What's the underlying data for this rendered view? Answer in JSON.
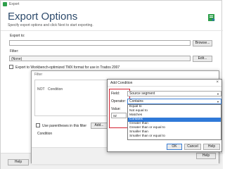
{
  "window": {
    "title": "Export"
  },
  "header": {
    "title": "Export Options",
    "subtitle": "Specify export options and click Next to start exporting."
  },
  "export_to": {
    "label": "Export to:",
    "value": "",
    "browse_label": "Browse..."
  },
  "filter": {
    "label": "Filter:",
    "value": "(None)",
    "edit_label": "Edit..."
  },
  "workbench": {
    "label": "Export to Workbench-optimized TMX format for use in Trados 2007",
    "checked": false
  },
  "footer": {
    "help_label": "Help"
  },
  "filter_dialog": {
    "title": "Filter",
    "tree": {
      "not_label": "NOT",
      "condition_label": "Condition"
    },
    "parentheses_label": "Use parentheses in this filter",
    "add_label": "Add...",
    "condition_label": "Condition",
    "help_label": "Help"
  },
  "add_condition": {
    "title": "Add Condition",
    "close_icon": "×",
    "field_label": "Field:",
    "field_value": "Source segment",
    "operator_label": "Operator:",
    "operator_value": "Contains",
    "value_label": "Value:",
    "value_value": "sz",
    "operator_options": [
      "Equal to",
      "Not equal to",
      "Matches",
      "Contains",
      "Greater than",
      "Greater than or equal to",
      "Smaller than",
      "Smaller than or equal to"
    ],
    "selected_option_index": 3,
    "ok_label": "OK",
    "cancel_label": "Cancel",
    "help_label": "Help"
  },
  "colors": {
    "accent": "#2f79d8",
    "highlight": "#d42030",
    "title": "#2d4a6b"
  }
}
